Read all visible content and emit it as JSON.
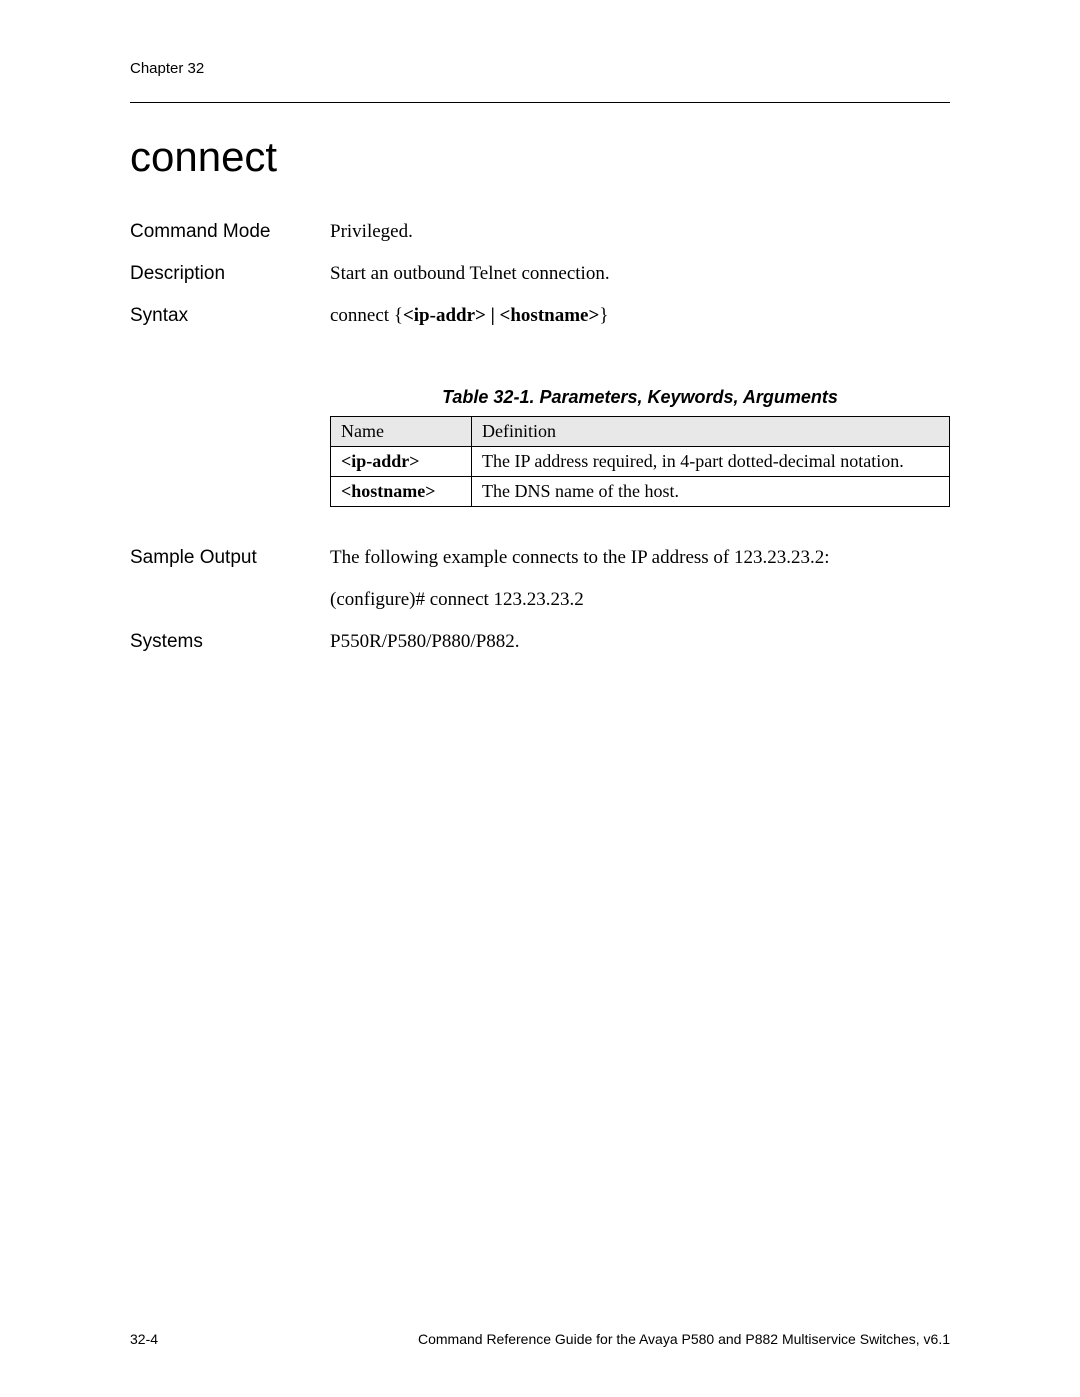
{
  "header": {
    "chapter": "Chapter 32"
  },
  "title": "connect",
  "rows": {
    "command_mode": {
      "label": "Command Mode",
      "value": "Privileged."
    },
    "description": {
      "label": "Description",
      "value": "Start an outbound Telnet connection."
    },
    "syntax": {
      "label": "Syntax",
      "value_prefix": "connect {",
      "value_args": "<ip-addr> | <hostname>",
      "value_suffix": "}"
    },
    "sample_output": {
      "label": "Sample Output",
      "line1": "The following example connects to the IP address of 123.23.23.2:",
      "line2": "(configure)# connect 123.23.23.2"
    },
    "systems": {
      "label": "Systems",
      "value": "P550R/P580/P880/P882."
    }
  },
  "table": {
    "caption": "Table 32-1. Parameters, Keywords, Arguments",
    "headers": {
      "name": "Name",
      "definition": "Definition"
    },
    "rows": [
      {
        "name": "<ip-addr>",
        "definition": "The IP address required, in 4-part dotted-decimal notation."
      },
      {
        "name": "<hostname>",
        "definition": "The DNS name of the host."
      }
    ]
  },
  "footer": {
    "left": "32-4",
    "right": "Command Reference Guide for the Avaya P580 and P882 Multiservice Switches, v6.1"
  }
}
